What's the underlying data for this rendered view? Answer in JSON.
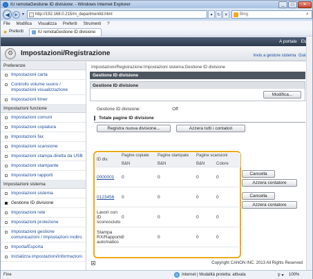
{
  "window": {
    "title": "IU remotaGestione ID divisione: - Windows Internet Explorer"
  },
  "address": {
    "url": "http://192.168.0.215/m_departmentId.html",
    "search_placeholder": "Bing"
  },
  "menu": [
    "File",
    "Modifica",
    "Visualizza",
    "Preferiti",
    "Strumenti",
    "?"
  ],
  "favorites": {
    "label": "Preferiti",
    "tab": "IU remotaGestione ID divisione:"
  },
  "top_links": {
    "portal": "A portale",
    "exit": "Esci"
  },
  "header": {
    "title": "Impostazioni/Registrazione",
    "link_manager": "Invio a gestore sistema",
    "link_guide": "Guida"
  },
  "sidebar": [
    {
      "type": "section",
      "label": "Preferenze"
    },
    {
      "type": "item",
      "label": "Impostazioni carta"
    },
    {
      "type": "item",
      "label": "Controllo volume suono / Impostazioni visualizzazione"
    },
    {
      "type": "item",
      "label": "Impostazioni timer"
    },
    {
      "type": "section",
      "label": "Impostazioni funzione"
    },
    {
      "type": "item",
      "label": "Impostazioni comuni"
    },
    {
      "type": "item",
      "label": "Impostazioni copiatura"
    },
    {
      "type": "item",
      "label": "Impostazioni fax"
    },
    {
      "type": "item",
      "label": "Impostazioni scansione"
    },
    {
      "type": "item",
      "label": "Impostazioni stampa diretta da USB"
    },
    {
      "type": "item",
      "label": "Impostazioni stampante"
    },
    {
      "type": "item",
      "label": "Impostazioni rapporti"
    },
    {
      "type": "section",
      "label": "Impostazioni sistema"
    },
    {
      "type": "item",
      "label": "Impostazioni sistema"
    },
    {
      "type": "item",
      "label": "Gestione ID divisione",
      "selected": true
    },
    {
      "type": "item",
      "label": "Impostazioni rete"
    },
    {
      "type": "item",
      "label": "Impostazioni protezione"
    },
    {
      "type": "item",
      "label": "Impostazioni gestione comunicazioni / Impostazioni inoltro"
    },
    {
      "type": "item",
      "label": "Importa/Esporta"
    },
    {
      "type": "item",
      "label": "Inizializza impostazioni/informazioni"
    }
  ],
  "main": {
    "breadcrumb": "Impostazioni/Registrazione:Impostazioni sistema:Gestione ID divisione",
    "bar_title": "Gestione ID divisione",
    "panel_title": "Gestione ID divisione",
    "edit_button": "Modifica...",
    "status_label": "Gestione ID divisione:",
    "status_value": "Off",
    "totals_title": "Totale pagine ID divisione",
    "register_button": "Registra nuova divisione...",
    "reset_all_button": "Azzera tutti i contatori",
    "table": {
      "header_id": "ID div.",
      "group_copy": "Pagine copiate",
      "group_print": "Pagine stampate",
      "group_scan": "Pagine scansioni",
      "sub_bw": "B&N",
      "sub_color": "Colore",
      "rows": [
        {
          "id": "0000001",
          "copy": "0",
          "print": "0",
          "scan_bw": "0",
          "scan_color": "0",
          "link": true
        },
        {
          "id": "0123456",
          "copy": "0",
          "print": "0",
          "scan_bw": "0",
          "scan_color": "0",
          "link": true
        },
        {
          "id": "Lavori con ID sconosciuto",
          "copy": "0",
          "print": "0",
          "scan_bw": "0",
          "scan_color": "0",
          "link": false
        },
        {
          "id": "Stampa RX/Rapporto automatico",
          "copy": "0",
          "print": "0",
          "scan_bw": "0",
          "scan_color": "0",
          "link": false
        }
      ]
    },
    "row_buttons": {
      "delete": "Cancella",
      "reset": "Azzera contatore"
    },
    "copyright": "Copyright CANON INC. 2013 All Rights Reserved"
  },
  "statusbar": {
    "left": "Fine",
    "zone": "Internet | Modalità protetta: attivata",
    "zoom": "100%"
  }
}
